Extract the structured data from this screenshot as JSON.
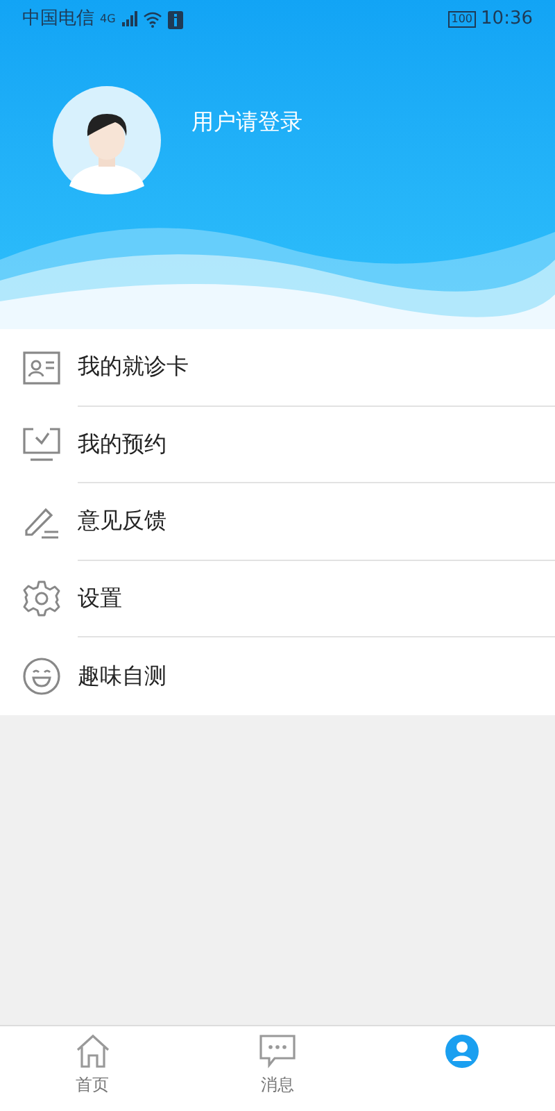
{
  "status_bar": {
    "carrier": "中国电信",
    "network": "4G",
    "battery": "100",
    "time": "10:36"
  },
  "profile": {
    "login_prompt": "用户请登录"
  },
  "menu": [
    {
      "kind": "card",
      "label": "我的就诊卡"
    },
    {
      "kind": "appointment",
      "label": "我的预约"
    },
    {
      "kind": "feedback",
      "label": "意见反馈"
    },
    {
      "kind": "settings",
      "label": "设置"
    },
    {
      "kind": "fun",
      "label": "趣味自测"
    }
  ],
  "tab_bar": [
    {
      "kind": "home",
      "label": "首页",
      "selected": false
    },
    {
      "kind": "messages",
      "label": "消息",
      "selected": false
    },
    {
      "kind": "mine",
      "selected": true
    }
  ]
}
